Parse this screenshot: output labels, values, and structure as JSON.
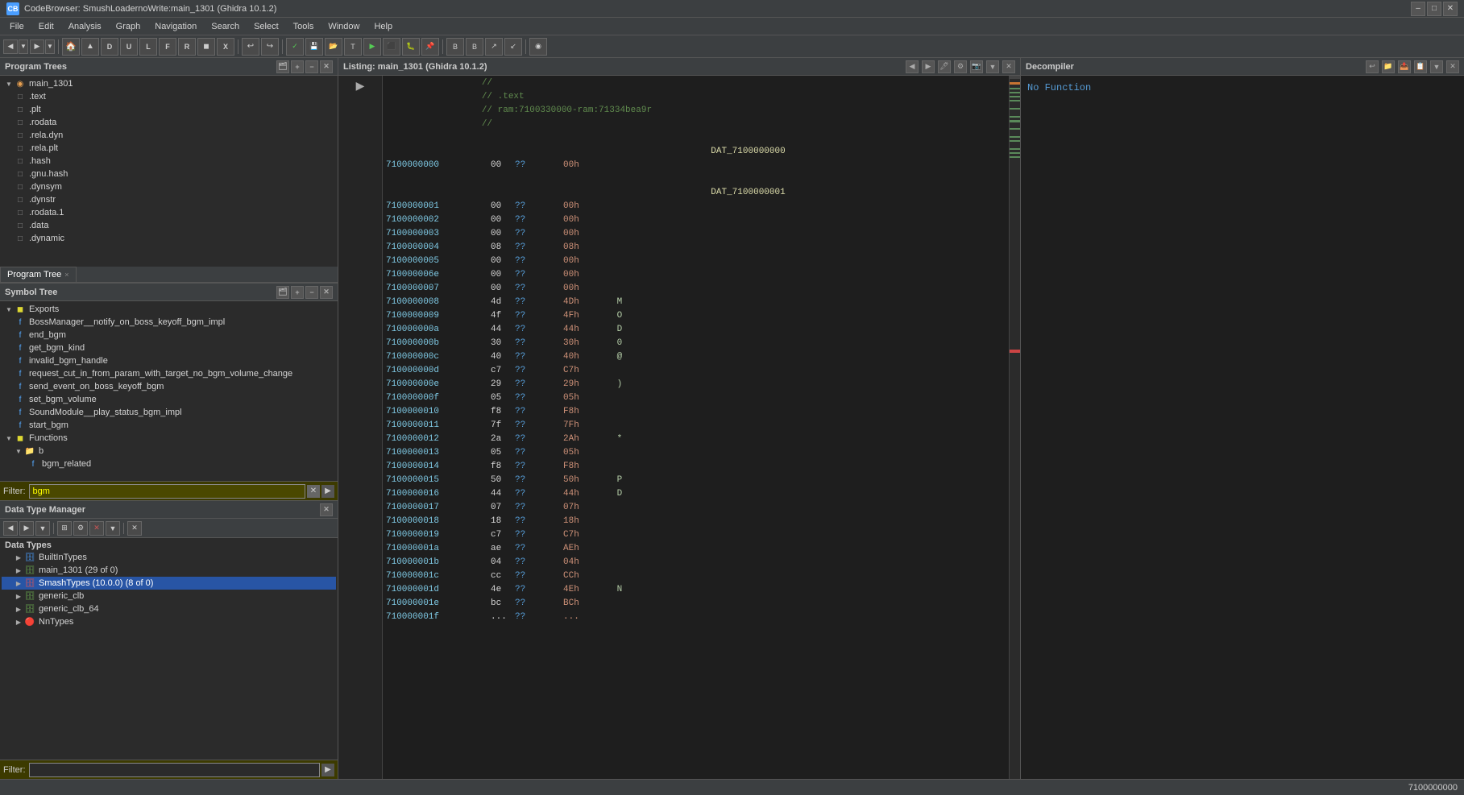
{
  "titleBar": {
    "title": "CodeBrowser: SmushLoadernoWrite:main_1301 (Ghidra 10.1.2)",
    "icon": "CB"
  },
  "menuBar": {
    "items": [
      "File",
      "Edit",
      "Analysis",
      "Graph",
      "Navigation",
      "Search",
      "Select",
      "Tools",
      "Window",
      "Help"
    ]
  },
  "panels": {
    "programTrees": {
      "title": "Program Trees",
      "rootNode": "main_1301",
      "sections": [
        {
          "name": ".text",
          "type": "section"
        },
        {
          "name": ".plt",
          "type": "section"
        },
        {
          "name": ".rodata",
          "type": "section"
        },
        {
          "name": ".rela.dyn",
          "type": "section"
        },
        {
          "name": ".rela.plt",
          "type": "section"
        },
        {
          "name": ".hash",
          "type": "section"
        },
        {
          "name": ".gnu.hash",
          "type": "section"
        },
        {
          "name": ".dynsym",
          "type": "section"
        },
        {
          "name": ".dynstr",
          "type": "section"
        },
        {
          "name": ".rodata.1",
          "type": "section"
        },
        {
          "name": ".data",
          "type": "section"
        },
        {
          "name": ".dynamic",
          "type": "section"
        }
      ],
      "tab": "Program Tree",
      "tabClose": "×"
    },
    "symbolTree": {
      "title": "Symbol Tree",
      "exports": {
        "label": "Exports",
        "items": [
          "BossManager__notify_on_boss_keyoff_bgm_impl",
          "end_bgm",
          "get_bgm_kind",
          "invalid_bgm_handle",
          "request_cut_in_from_param_with_target_no_bgm_volume_change",
          "send_event_on_boss_keyoff_bgm",
          "set_bgm_volume",
          "SoundModule__play_status_bgm_impl",
          "start_bgm"
        ]
      },
      "functions": {
        "label": "Functions",
        "items": [
          {
            "name": "b",
            "type": "folder"
          },
          {
            "name": "bgm_related",
            "type": "function",
            "indent": 2
          }
        ]
      },
      "filter": {
        "label": "Filter:",
        "value": "bgm"
      }
    },
    "dataTypeManager": {
      "title": "Data Type Manager",
      "items": [
        {
          "name": "Data Types",
          "type": "header"
        },
        {
          "name": "BuiltInTypes",
          "type": "archive",
          "icon": "builtin"
        },
        {
          "name": "main_1301 (29 of 0)",
          "type": "archive",
          "icon": "archive"
        },
        {
          "name": "SmashTypes (10.0.0) (8 of 0)",
          "type": "archive",
          "icon": "archive",
          "selected": true
        },
        {
          "name": "generic_clb",
          "type": "archive"
        },
        {
          "name": "generic_clb_64",
          "type": "archive"
        },
        {
          "name": "NnTypes",
          "type": "archive",
          "icon": "red"
        }
      ],
      "filter": {
        "label": "Filter:",
        "value": ""
      }
    },
    "listing": {
      "title": "Listing: main_1301 (Ghidra 10.1.2)",
      "rows": [
        {
          "type": "comment",
          "text": "//"
        },
        {
          "type": "comment",
          "text": "//  .text"
        },
        {
          "type": "comment",
          "text": "//  ram:7100330000-ram:71334bea9r"
        },
        {
          "type": "comment",
          "text": "//"
        },
        {
          "type": "blank"
        },
        {
          "type": "label",
          "text": "DAT_7100000000"
        },
        {
          "addr": "7100000000",
          "byte": "00",
          "mnem": "??",
          "hex": "00h",
          "char": ""
        },
        {
          "type": "blank"
        },
        {
          "type": "label",
          "text": "DAT_7100000001"
        },
        {
          "addr": "7100000001",
          "byte": "00",
          "mnem": "??",
          "hex": "00h",
          "char": ""
        },
        {
          "addr": "7100000002",
          "byte": "00",
          "mnem": "??",
          "hex": "00h",
          "char": ""
        },
        {
          "addr": "7100000003",
          "byte": "00",
          "mnem": "??",
          "hex": "00h",
          "char": ""
        },
        {
          "addr": "7100000004",
          "byte": "08",
          "mnem": "??",
          "hex": "08h",
          "char": ""
        },
        {
          "addr": "7100000005",
          "byte": "00",
          "mnem": "??",
          "hex": "00h",
          "char": ""
        },
        {
          "addr": "710000006e",
          "byte": "00",
          "mnem": "??",
          "hex": "00h",
          "char": ""
        },
        {
          "addr": "7100000007",
          "byte": "00",
          "mnem": "??",
          "hex": "00h",
          "char": ""
        },
        {
          "addr": "7100000008",
          "byte": "4d",
          "mnem": "??",
          "hex": "4Dh",
          "char": "M"
        },
        {
          "addr": "7100000009",
          "byte": "4f",
          "mnem": "??",
          "hex": "4Fh",
          "char": "O"
        },
        {
          "addr": "710000000a",
          "byte": "44",
          "mnem": "??",
          "hex": "44h",
          "char": "D"
        },
        {
          "addr": "710000000b",
          "byte": "30",
          "mnem": "??",
          "hex": "30h",
          "char": "0"
        },
        {
          "addr": "710000000c",
          "byte": "40",
          "mnem": "??",
          "hex": "40h",
          "char": "@"
        },
        {
          "addr": "710000000d",
          "byte": "c7",
          "mnem": "??",
          "hex": "C7h",
          "char": ""
        },
        {
          "addr": "710000000e",
          "byte": "29",
          "mnem": "??",
          "hex": "29h",
          "char": ")"
        },
        {
          "addr": "710000000f",
          "byte": "05",
          "mnem": "??",
          "hex": "05h",
          "char": ""
        },
        {
          "addr": "7100000010",
          "byte": "f8",
          "mnem": "??",
          "hex": "F8h",
          "char": ""
        },
        {
          "addr": "7100000011",
          "byte": "7f",
          "mnem": "??",
          "hex": "7Fh",
          "char": ""
        },
        {
          "addr": "7100000012",
          "byte": "2a",
          "mnem": "??",
          "hex": "2Ah",
          "char": "*"
        },
        {
          "addr": "7100000013",
          "byte": "05",
          "mnem": "??",
          "hex": "05h",
          "char": ""
        },
        {
          "addr": "7100000014",
          "byte": "f8",
          "mnem": "??",
          "hex": "F8h",
          "char": ""
        },
        {
          "addr": "7100000015",
          "byte": "50",
          "mnem": "??",
          "hex": "50h",
          "char": "P"
        },
        {
          "addr": "7100000016",
          "byte": "44",
          "mnem": "??",
          "hex": "44h",
          "char": "D"
        },
        {
          "addr": "7100000017",
          "byte": "07",
          "mnem": "??",
          "hex": "07h",
          "char": ""
        },
        {
          "addr": "7100000018",
          "byte": "18",
          "mnem": "??",
          "hex": "18h",
          "char": ""
        },
        {
          "addr": "7100000019",
          "byte": "c7",
          "mnem": "??",
          "hex": "C7h",
          "char": ""
        },
        {
          "addr": "710000001a",
          "byte": "ae",
          "mnem": "??",
          "hex": "AEh",
          "char": ""
        },
        {
          "addr": "710000001b",
          "byte": "04",
          "mnem": "??",
          "hex": "04h",
          "char": ""
        },
        {
          "addr": "710000001c",
          "byte": "cc",
          "mnem": "??",
          "hex": "CCh",
          "char": ""
        },
        {
          "addr": "710000001d",
          "byte": "4e",
          "mnem": "??",
          "hex": "4Eh",
          "char": "N"
        },
        {
          "addr": "710000001e",
          "byte": "bc",
          "mnem": "??",
          "hex": "BCh",
          "char": ""
        },
        {
          "addr": "710000001f",
          "byte": "...",
          "mnem": "??",
          "hex": "...",
          "char": ""
        }
      ]
    },
    "decompiler": {
      "title": "Decompiler",
      "content": "No Function"
    }
  },
  "statusBar": {
    "address": "7100000000"
  }
}
